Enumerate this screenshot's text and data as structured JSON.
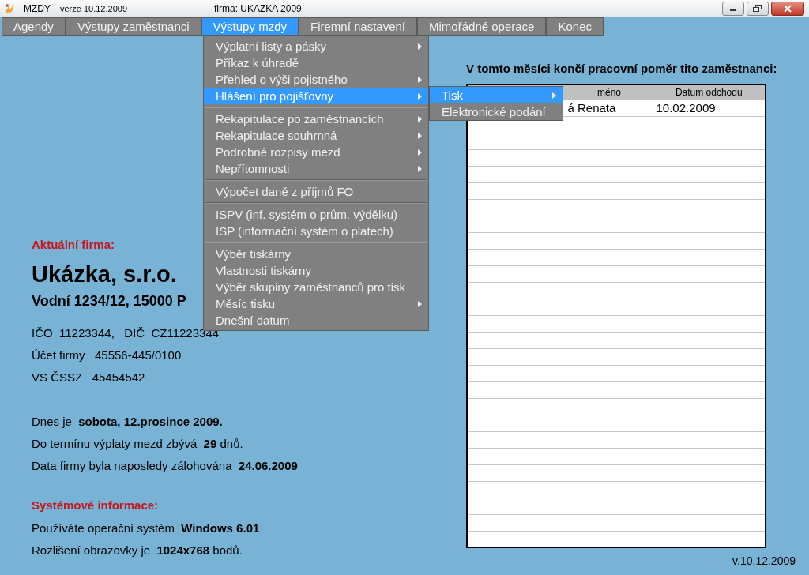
{
  "title_bar": {
    "app": "MZDY",
    "version": "verze 10.12.2009",
    "firm": "firma: UKAZKA 2009"
  },
  "menu_bar": [
    {
      "label": "Agendy",
      "selected": false
    },
    {
      "label": "Výstupy zaměstnanci",
      "selected": false
    },
    {
      "label": "Výstupy mzdy",
      "selected": true
    },
    {
      "label": "Firemní nastavení",
      "selected": false
    },
    {
      "label": "Mimořádné operace",
      "selected": false
    },
    {
      "label": "Konec",
      "selected": false
    }
  ],
  "dropdown": [
    {
      "kind": "item",
      "label": "Výplatní listy a pásky",
      "submenu": true,
      "selected": false
    },
    {
      "kind": "item",
      "label": "Příkaz k úhradě",
      "submenu": false,
      "selected": false
    },
    {
      "kind": "item",
      "label": "Přehled o výši pojistného",
      "submenu": true,
      "selected": false
    },
    {
      "kind": "item",
      "label": "Hlášení pro pojišťovny",
      "submenu": true,
      "selected": true
    },
    {
      "kind": "separator"
    },
    {
      "kind": "item",
      "label": "Rekapitulace po zaměstnancích",
      "submenu": true,
      "selected": false
    },
    {
      "kind": "item",
      "label": "Rekapitulace souhrnná",
      "submenu": true,
      "selected": false
    },
    {
      "kind": "item",
      "label": "Podrobné rozpisy mezd",
      "submenu": true,
      "selected": false
    },
    {
      "kind": "item",
      "label": "Nepřítomnosti",
      "submenu": true,
      "selected": false
    },
    {
      "kind": "separator"
    },
    {
      "kind": "item",
      "label": "Výpočet daně z příjmů FO",
      "submenu": false,
      "selected": false
    },
    {
      "kind": "separator"
    },
    {
      "kind": "item",
      "label": "ISPV (inf. systém o prům. výdělku)",
      "submenu": false,
      "selected": false
    },
    {
      "kind": "item",
      "label": "ISP (informační systém o platech)",
      "submenu": false,
      "selected": false
    },
    {
      "kind": "separator"
    },
    {
      "kind": "item",
      "label": "Výběr tiskárny",
      "submenu": false,
      "selected": false
    },
    {
      "kind": "item",
      "label": "Vlastnosti tiskárny",
      "submenu": false,
      "selected": false
    },
    {
      "kind": "item",
      "label": "Výběr skupiny zaměstnanců pro tisk",
      "submenu": false,
      "selected": false
    },
    {
      "kind": "item",
      "label": "Měsíc tisku",
      "submenu": true,
      "selected": false
    },
    {
      "kind": "item",
      "label": "Dnešní datum",
      "submenu": false,
      "selected": false
    }
  ],
  "submenu": [
    {
      "label": "Tisk",
      "submenu": true,
      "selected": true
    },
    {
      "label": "Elektronické podání",
      "submenu": false,
      "selected": false
    }
  ],
  "company": {
    "heading": "Aktuální firma:",
    "name": "Ukázka, s.r.o.",
    "address": "Vodní 1234/12, 15000 P",
    "ids": [
      "IČO  11223344,   DIČ  CZ11223344",
      "Účet firmy   45556-445/0100",
      "VS ČSSZ   45454542"
    ],
    "status": [
      "Dnes je  **sobota, 12.prosince 2009.**",
      "Do termínu výplaty mezd zbývá  **29** dnů.",
      "Data firmy byla naposledy zálohována  **24.06.2009**"
    ]
  },
  "system": {
    "heading": "Systémové informace:",
    "lines": [
      "Používáte operační systém  **Windows 6.01**",
      "Rozlišení obrazovky je  **1024x768** bodů."
    ]
  },
  "leavers": {
    "title": "V tomto měsíci končí pracovní poměr tito zaměstnanci:",
    "columns": [
      "méno",
      "Datum odchodu"
    ],
    "rows": [
      [
        "á Renata",
        "10.02.2009"
      ]
    ]
  },
  "footer_version": "v.10.12.2009"
}
